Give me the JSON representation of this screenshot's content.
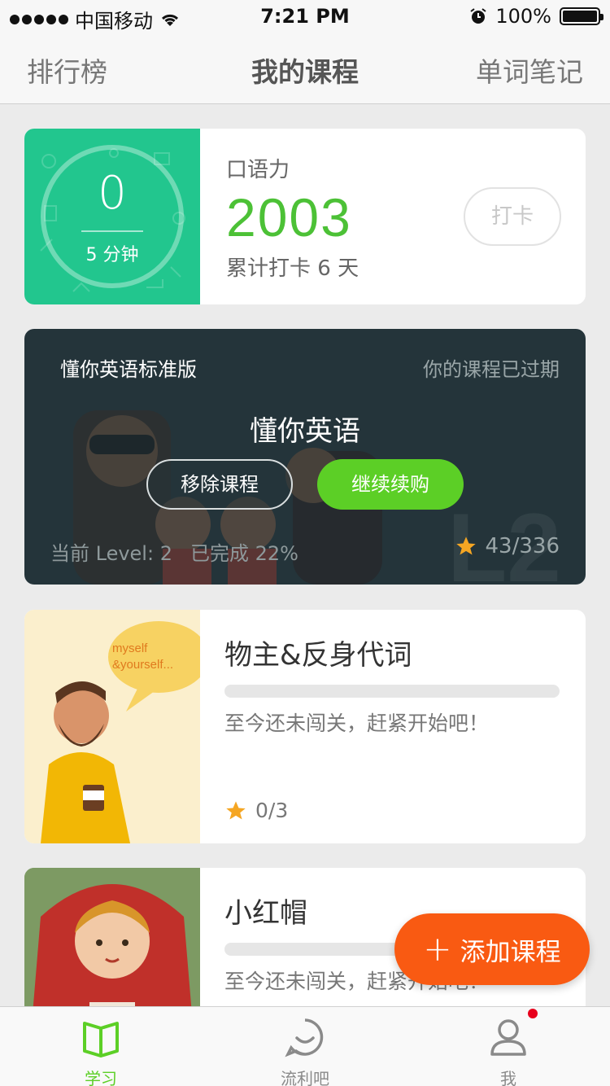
{
  "status_bar": {
    "carrier": "中国移动",
    "time": "7:21 PM",
    "battery": "100%",
    "battery_level": 1.0
  },
  "top_nav": {
    "left": "排行榜",
    "center": "我的课程",
    "right": "单词笔记"
  },
  "checkin_card": {
    "ring_value": "0",
    "ring_label": "5 分钟",
    "label": "口语力",
    "score": "2003",
    "days": "累计打卡 6 天",
    "button": "打卡"
  },
  "expired_course": {
    "course_name": "懂你英语标准版",
    "expired_text": "你的课程已过期",
    "title": "懂你英语",
    "remove_button": "移除课程",
    "renew_button": "继续续购",
    "level_text": "当前 Level: 2",
    "completed_text": "已完成 22%",
    "stars": "43/336"
  },
  "courses": [
    {
      "title": "物主&反身代词",
      "status": "至今还未闯关，赶紧开始吧！",
      "stars": "0/3",
      "progress": 0,
      "bubble_line1": "myself",
      "bubble_line2": "&yourself..."
    },
    {
      "title": "小红帽",
      "status": "至今还未闯关，赶紧开始吧！",
      "progress": 0
    }
  ],
  "fab": {
    "label": "添加课程"
  },
  "tab_bar": {
    "items": [
      {
        "label": "学习",
        "icon": "book-icon",
        "active": true
      },
      {
        "label": "流利吧",
        "icon": "smile-chat-icon",
        "active": false
      },
      {
        "label": "我",
        "icon": "person-icon",
        "active": false
      }
    ]
  },
  "colors": {
    "accent_green": "#5ccf26",
    "card_teal": "#22c68e",
    "fab_orange": "#f95a12",
    "notification_red": "#e8001c"
  }
}
